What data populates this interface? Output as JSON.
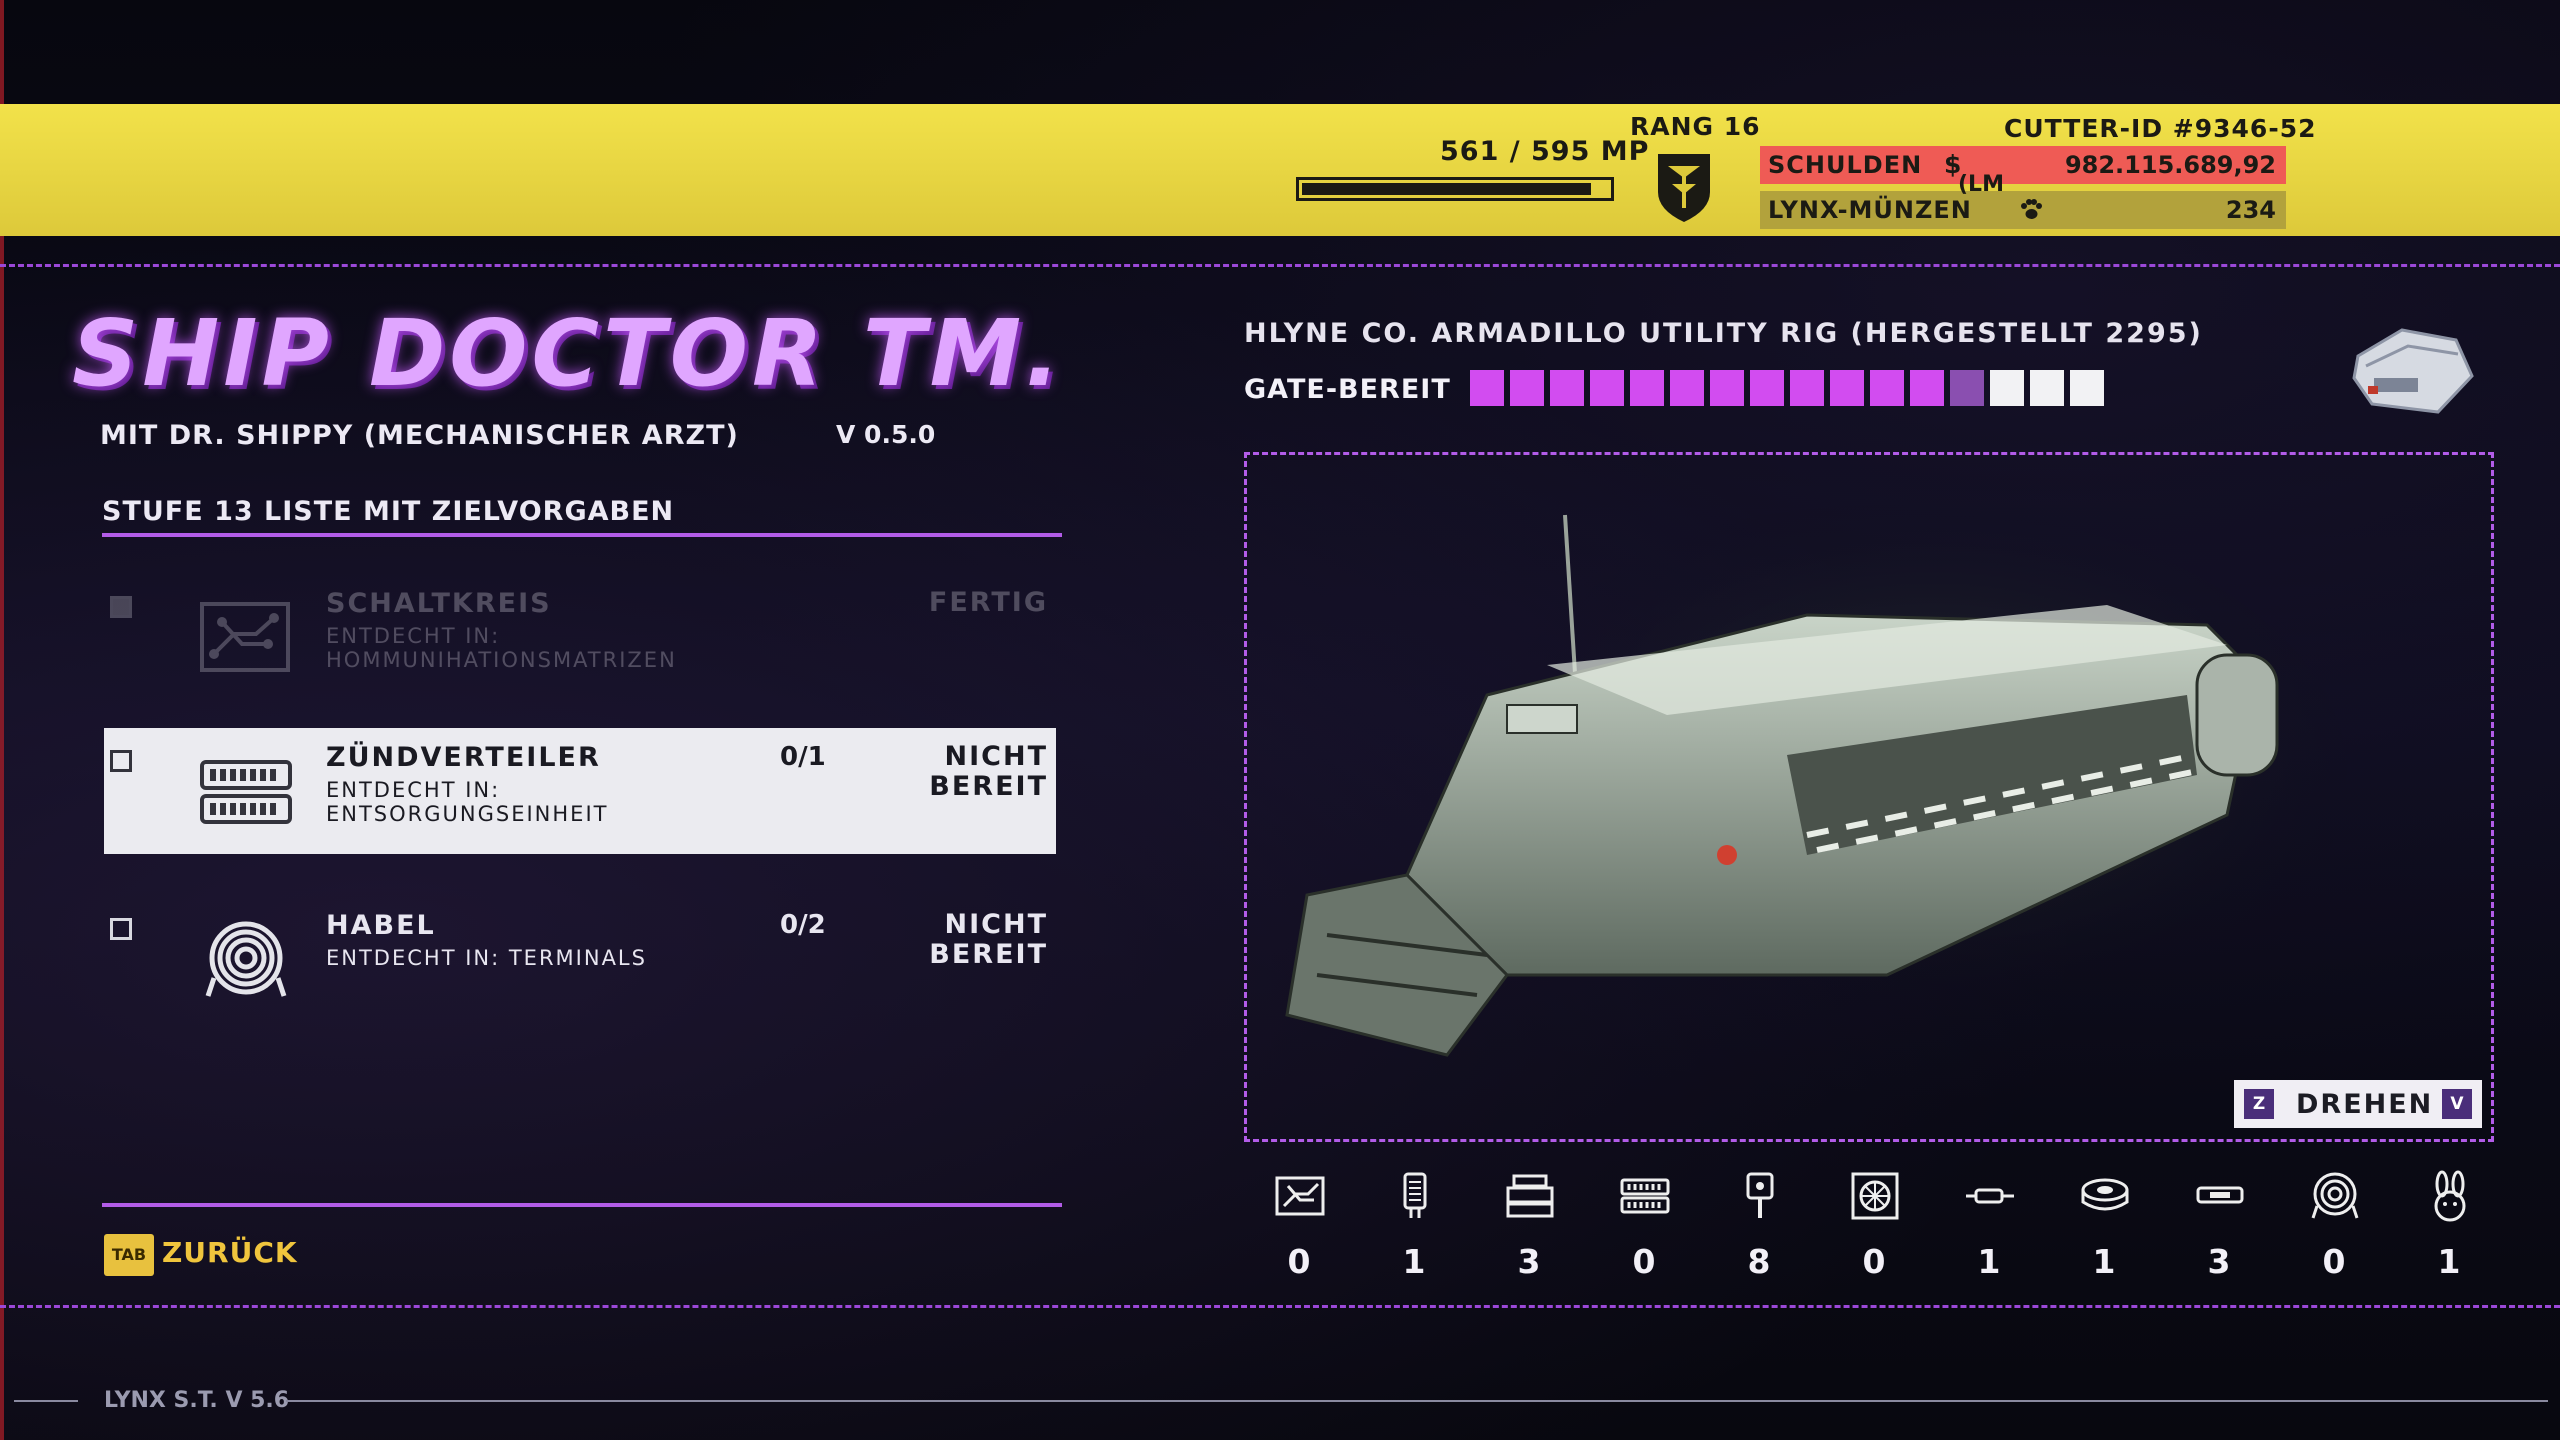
{
  "hud": {
    "mp_text": "561 / 595 MP",
    "mp_current": 561,
    "mp_max": 595,
    "rank_label": "RANG 16",
    "cutter_id": "CUTTER-ID  #9346-52",
    "debt_label": "SCHULDEN",
    "debt_symbol": "$",
    "debt_value": "982.115.689,92",
    "lm_tag": "(LM",
    "coins_label": "LYNX-MÜNZEN",
    "coins_value": "234",
    "colors": {
      "bar": "#f2e24a",
      "debt": "#ef5b55",
      "coins": "#b2a23c"
    }
  },
  "left": {
    "title": "SHIP DOCTOR TM.",
    "subtitle": "MIT DR. SHIPPY (MECHANISCHER ARZT)",
    "version": "V 0.5.0",
    "list_heading": "STUFE 13 LISTE MIT ZIELVORGABEN",
    "items": [
      {
        "name": "SCHALTKREIS",
        "found": "ENTDECHT IN: HOMMUNIHATIONSMATRIZEN",
        "count": "",
        "state": "FERTIG",
        "icon": "circuit-board-icon",
        "done": true
      },
      {
        "name": "ZÜNDVERTEILER",
        "found": "ENTDECHT IN: ENTSORGUNGSEINHEIT",
        "count": "0/1",
        "state": "NICHT BEREIT",
        "icon": "distributor-icon",
        "selected": true
      },
      {
        "name": "HABEL",
        "found": "ENTDECHT IN: TERMINALS",
        "count": "0/2",
        "state": "NICHT BEREIT",
        "icon": "cable-coil-icon"
      }
    ],
    "back_key": "TAB",
    "back_label": "ZURÜCK"
  },
  "right": {
    "ship_name": "HLYNE CO. ARMADILLO UTILITY RIG (HERGESTELLT 2295)",
    "gate_label": "GATE-BEREIT",
    "gate_filled": 12,
    "gate_partial": 1,
    "gate_empty": 3,
    "gate_colors": {
      "filled": "#d24cf0",
      "partial": "#8a4fb0",
      "empty": "#f2f2f4"
    },
    "rotate_key_left": "Z",
    "rotate_label": "DREHEN",
    "rotate_key_right": "V",
    "inventory": [
      {
        "icon": "circuit-board-icon",
        "count": "0"
      },
      {
        "icon": "fuse-icon",
        "count": "1"
      },
      {
        "icon": "engine-block-icon",
        "count": "3"
      },
      {
        "icon": "distributor-icon",
        "count": "0"
      },
      {
        "icon": "plug-icon",
        "count": "8"
      },
      {
        "icon": "fan-unit-icon",
        "count": "0"
      },
      {
        "icon": "connector-icon",
        "count": "1"
      },
      {
        "icon": "tape-roll-icon",
        "count": "1"
      },
      {
        "icon": "pipe-icon",
        "count": "3"
      },
      {
        "icon": "cable-coil-icon",
        "count": "0"
      },
      {
        "icon": "bunny-icon",
        "count": "1"
      }
    ]
  },
  "footer": {
    "version_label": "LYNX S.T. V 5.6"
  }
}
